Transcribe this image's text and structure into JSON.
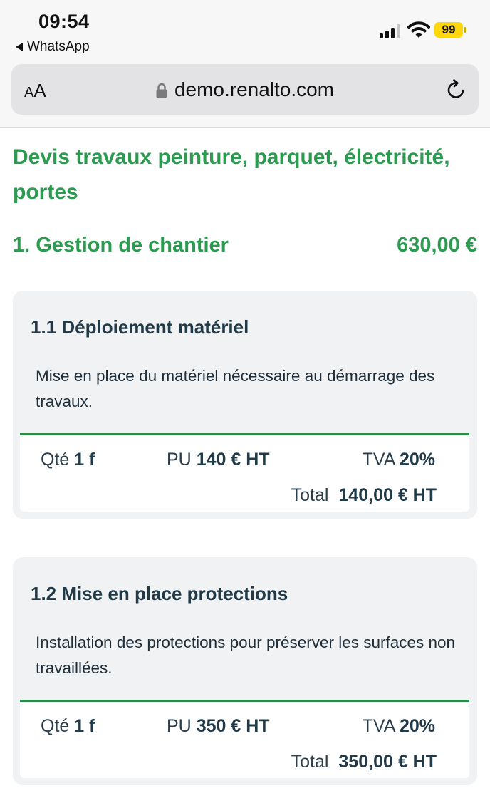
{
  "status_bar": {
    "time": "09:54",
    "back_app": "WhatsApp",
    "battery_level": "99",
    "battery_color": "#ffd60a"
  },
  "browser": {
    "text_size_button": "AA",
    "url": "demo.renalto.com"
  },
  "page": {
    "title": "Devis travaux peinture, parquet, électricité, portes",
    "accent_color": "#2b9b4f"
  },
  "section": {
    "title": "1. Gestion de chantier",
    "amount": "630,00 €"
  },
  "items": [
    {
      "title": "1.1 Déploiement matériel",
      "description": "Mise en place du matériel nécessaire au démarrage des travaux.",
      "qty_label": "Qté",
      "qty_value": "1 f",
      "pu_label": "PU",
      "pu_value": "140 € HT",
      "tva_label": "TVA",
      "tva_value": "20%",
      "total_label": "Total",
      "total_value": "140,00 € HT"
    },
    {
      "title": "1.2 Mise en place protections",
      "description": "Installation des protections pour préserver les surfaces non travaillées.",
      "qty_label": "Qté",
      "qty_value": "1 f",
      "pu_label": "PU",
      "pu_value": "350 € HT",
      "tva_label": "TVA",
      "tva_value": "20%",
      "total_label": "Total",
      "total_value": "350,00 € HT"
    }
  ]
}
